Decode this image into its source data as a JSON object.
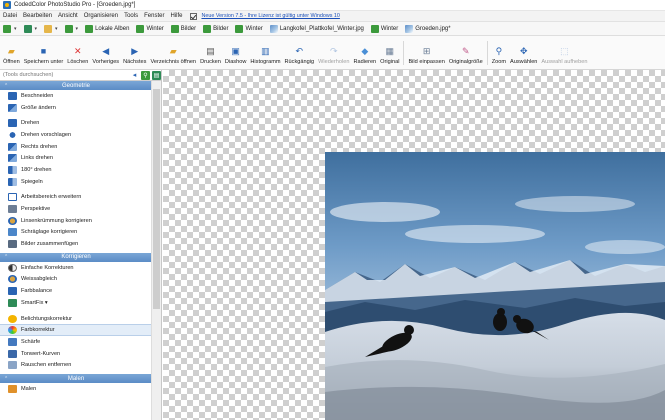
{
  "window": {
    "title": "CodedColor PhotoStudio Pro - [Groeden.jpg*]"
  },
  "menu": {
    "items": [
      "Datei",
      "Bearbeiten",
      "Ansicht",
      "Organisieren",
      "Tools",
      "Fenster",
      "Hilfe"
    ],
    "update_notice": "Neue Version 7.5 - Ihre Lizenz ist gültig unter Windows 10"
  },
  "tabs": {
    "items": [
      {
        "label": "",
        "icon": "green-square-icon"
      },
      {
        "label": "",
        "icon": "green-square-icon"
      },
      {
        "label": "",
        "icon": "folder-icon"
      },
      {
        "label": "",
        "icon": "green-square-icon"
      },
      {
        "label": "Lokale Alben",
        "icon": "green-square-icon"
      },
      {
        "label": "Winter",
        "icon": "green-square-icon"
      },
      {
        "label": "Bilder",
        "icon": "green-square-icon"
      },
      {
        "label": "Bilder",
        "icon": "green-square-icon"
      },
      {
        "label": "Winter",
        "icon": "green-square-icon"
      },
      {
        "label": "Langkofel_Plattkofel_Winter.jpg",
        "icon": "image-icon"
      },
      {
        "label": "Winter",
        "icon": "green-square-icon"
      },
      {
        "label": "Groeden.jpg*",
        "icon": "image-icon"
      }
    ]
  },
  "toolbar": {
    "offnen": "Öffnen",
    "speichern": "Speichern unter",
    "loschen": "Löschen",
    "vorheriges": "Vorheriges",
    "nachstes": "Nächstes",
    "verzeichnis": "Verzeichnis öffnen",
    "drucken": "Drucken",
    "diashow": "Diashow",
    "histogramm": "Histogramm",
    "ruckgangig": "Rückgängig",
    "wiederholen": "Wiederholen",
    "radieren": "Radieren",
    "original": "Original",
    "bild_einpassen": "Bild einpassen",
    "originalgrosse": "Originalgröße",
    "zoom": "Zoom",
    "auswahlen": "Auswählen",
    "auswahl_aufheben": "Auswahl aufheben"
  },
  "sidebar": {
    "search_placeholder": "(Tools durchsuchen)",
    "sections": {
      "geometrie": "Geometrie",
      "korrigieren": "Korrigieren",
      "malen": "Malen"
    },
    "geometrie_items": [
      "Beschneiden",
      "Größe ändern",
      "Drehen",
      "Drehen vorschlagen",
      "Rechts drehen",
      "Links drehen",
      "180° drehen",
      "Spiegeln",
      "Arbeitsbereich erweitern",
      "Perspektive",
      "Linsenkrümmung korrigieren",
      "Schräglage korrigieren",
      "Bilder zusammenfügen"
    ],
    "korrigieren_items": [
      "Einfache Korrekturen",
      "Weissabgleich",
      "Farbbalance",
      "SmartFix ▾",
      "Belichtungskorrektur",
      "Farbkorrektur",
      "Schärfe",
      "Tonwert-Kurven",
      "Rauschen entfernen"
    ],
    "malen_items": [
      "Malen"
    ]
  },
  "colors": {
    "section_header": "#5b8cc6",
    "selection": "#e3edf8",
    "link": "#1a4fb8"
  }
}
